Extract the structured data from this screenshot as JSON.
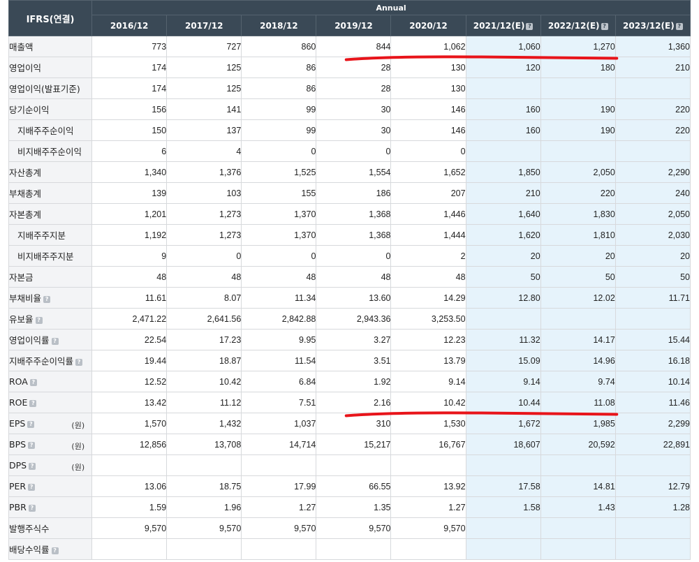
{
  "header": {
    "label": "IFRS(연결)",
    "period_group": "Annual",
    "help_glyph": "?",
    "years": [
      "2016/12",
      "2017/12",
      "2018/12",
      "2019/12",
      "2020/12",
      "2021/12(E)",
      "2022/12(E)",
      "2023/12(E)"
    ],
    "estimate_flags": [
      false,
      false,
      false,
      false,
      false,
      true,
      true,
      true
    ]
  },
  "rows": [
    {
      "label": "매출액",
      "indent": false,
      "help": false,
      "unit": "",
      "values": [
        "773",
        "727",
        "860",
        "844",
        "1,062",
        "1,060",
        "1,270",
        "1,360"
      ]
    },
    {
      "label": "영업이익",
      "indent": false,
      "help": false,
      "unit": "",
      "values": [
        "174",
        "125",
        "86",
        "28",
        "130",
        "120",
        "180",
        "210"
      ]
    },
    {
      "label": "영업이익(발표기준)",
      "indent": false,
      "help": false,
      "unit": "",
      "values": [
        "174",
        "125",
        "86",
        "28",
        "130",
        "",
        "",
        ""
      ]
    },
    {
      "label": "당기순이익",
      "indent": false,
      "help": false,
      "unit": "",
      "values": [
        "156",
        "141",
        "99",
        "30",
        "146",
        "160",
        "190",
        "220"
      ]
    },
    {
      "label": "지배주주순이익",
      "indent": true,
      "help": false,
      "unit": "",
      "values": [
        "150",
        "137",
        "99",
        "30",
        "146",
        "160",
        "190",
        "220"
      ]
    },
    {
      "label": "비지배주주순이익",
      "indent": true,
      "help": false,
      "unit": "",
      "values": [
        "6",
        "4",
        "0",
        "0",
        "0",
        "",
        "",
        ""
      ]
    },
    {
      "label": "자산총계",
      "indent": false,
      "help": false,
      "unit": "",
      "values": [
        "1,340",
        "1,376",
        "1,525",
        "1,554",
        "1,652",
        "1,850",
        "2,050",
        "2,290"
      ]
    },
    {
      "label": "부채총계",
      "indent": false,
      "help": false,
      "unit": "",
      "values": [
        "139",
        "103",
        "155",
        "186",
        "207",
        "210",
        "220",
        "240"
      ]
    },
    {
      "label": "자본총계",
      "indent": false,
      "help": false,
      "unit": "",
      "values": [
        "1,201",
        "1,273",
        "1,370",
        "1,368",
        "1,446",
        "1,640",
        "1,830",
        "2,050"
      ]
    },
    {
      "label": "지배주주지분",
      "indent": true,
      "help": false,
      "unit": "",
      "values": [
        "1,192",
        "1,273",
        "1,370",
        "1,368",
        "1,444",
        "1,620",
        "1,810",
        "2,030"
      ]
    },
    {
      "label": "비지배주주지분",
      "indent": true,
      "help": false,
      "unit": "",
      "values": [
        "9",
        "0",
        "0",
        "0",
        "2",
        "20",
        "20",
        "20"
      ]
    },
    {
      "label": "자본금",
      "indent": false,
      "help": false,
      "unit": "",
      "values": [
        "48",
        "48",
        "48",
        "48",
        "48",
        "50",
        "50",
        "50"
      ]
    },
    {
      "label": "부채비율",
      "indent": false,
      "help": true,
      "unit": "",
      "values": [
        "11.61",
        "8.07",
        "11.34",
        "13.60",
        "14.29",
        "12.80",
        "12.02",
        "11.71"
      ]
    },
    {
      "label": "유보율",
      "indent": false,
      "help": true,
      "unit": "",
      "values": [
        "2,471.22",
        "2,641.56",
        "2,842.88",
        "2,943.36",
        "3,253.50",
        "",
        "",
        ""
      ]
    },
    {
      "label": "영업이익률",
      "indent": false,
      "help": true,
      "unit": "",
      "values": [
        "22.54",
        "17.23",
        "9.95",
        "3.27",
        "12.23",
        "11.32",
        "14.17",
        "15.44"
      ]
    },
    {
      "label": "지배주주순이익률",
      "indent": false,
      "help": true,
      "unit": "",
      "values": [
        "19.44",
        "18.87",
        "11.54",
        "3.51",
        "13.79",
        "15.09",
        "14.96",
        "16.18"
      ]
    },
    {
      "label": "ROA",
      "indent": false,
      "help": true,
      "unit": "",
      "values": [
        "12.52",
        "10.42",
        "6.84",
        "1.92",
        "9.14",
        "9.14",
        "9.74",
        "10.14"
      ]
    },
    {
      "label": "ROE",
      "indent": false,
      "help": true,
      "unit": "",
      "values": [
        "13.42",
        "11.12",
        "7.51",
        "2.16",
        "10.42",
        "10.44",
        "11.08",
        "11.46"
      ]
    },
    {
      "label": "EPS",
      "indent": false,
      "help": true,
      "unit": "(원)",
      "values": [
        "1,570",
        "1,432",
        "1,037",
        "310",
        "1,530",
        "1,672",
        "1,985",
        "2,299"
      ]
    },
    {
      "label": "BPS",
      "indent": false,
      "help": true,
      "unit": "(원)",
      "values": [
        "12,856",
        "13,708",
        "14,714",
        "15,217",
        "16,767",
        "18,607",
        "20,592",
        "22,891"
      ]
    },
    {
      "label": "DPS",
      "indent": false,
      "help": true,
      "unit": "(원)",
      "values": [
        "",
        "",
        "",
        "",
        "",
        "",
        "",
        ""
      ]
    },
    {
      "label": "PER",
      "indent": false,
      "help": true,
      "unit": "",
      "values": [
        "13.06",
        "18.75",
        "17.99",
        "66.55",
        "13.92",
        "17.58",
        "14.81",
        "12.79"
      ]
    },
    {
      "label": "PBR",
      "indent": false,
      "help": true,
      "unit": "",
      "values": [
        "1.59",
        "1.96",
        "1.27",
        "1.35",
        "1.27",
        "1.58",
        "1.43",
        "1.28"
      ]
    },
    {
      "label": "발행주식수",
      "indent": false,
      "help": false,
      "unit": "",
      "values": [
        "9,570",
        "9,570",
        "9,570",
        "9,570",
        "9,570",
        "",
        "",
        ""
      ]
    },
    {
      "label": "배당수익률",
      "indent": false,
      "help": true,
      "unit": "",
      "values": [
        "",
        "",
        "",
        "",
        "",
        "",
        "",
        ""
      ]
    }
  ],
  "annotations": {
    "stroke_color": "#e8141a",
    "underlines": [
      {
        "row": "매출액",
        "from_year": "2019/12",
        "to_year": "2022/12(E)"
      },
      {
        "row": "ROE",
        "from_year": "2019/12",
        "to_year": "2022/12(E)"
      }
    ]
  },
  "colors": {
    "header_bg": "#3a4956",
    "label_bg": "#f3f4f6",
    "estimate_bg": "#e6f3fb",
    "border": "#d7d9dc"
  }
}
